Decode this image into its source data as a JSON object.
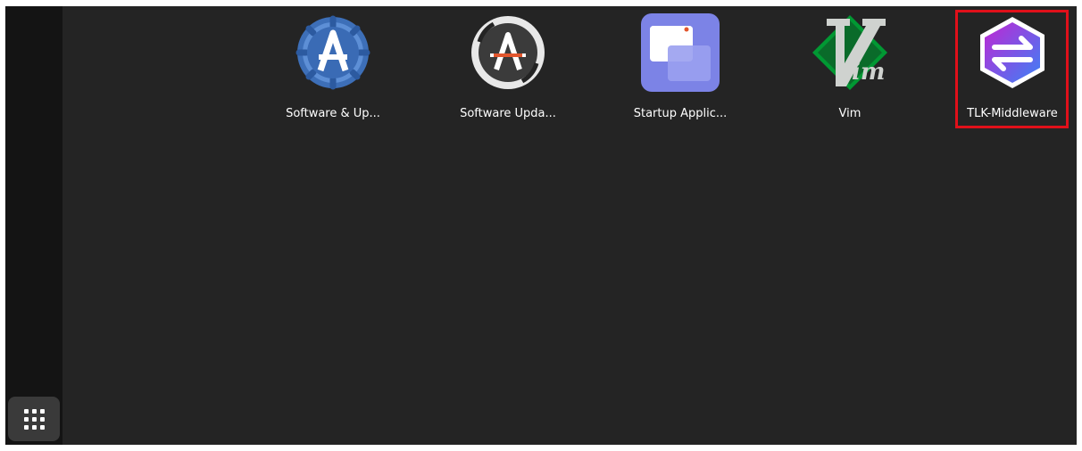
{
  "apps": [
    {
      "label": "Software & Up...",
      "icon": "software-properties-icon"
    },
    {
      "label": "Software Upda...",
      "icon": "software-updater-icon"
    },
    {
      "label": "Startup Applic...",
      "icon": "startup-applications-icon"
    },
    {
      "label": "Vim",
      "icon": "vim-icon"
    },
    {
      "label": "TLK-Middleware",
      "icon": "tlk-middleware-icon"
    }
  ],
  "dock": {
    "show_apps_icon": "app-grid-icon"
  },
  "colors": {
    "background": "#242424",
    "dock": "#141414",
    "highlight_border": "#e0101a",
    "tlk_gradient_start": "#c026d3",
    "tlk_gradient_end": "#3b82f6",
    "startup_icon": "#7c83e6",
    "vim_green": "#019833"
  }
}
